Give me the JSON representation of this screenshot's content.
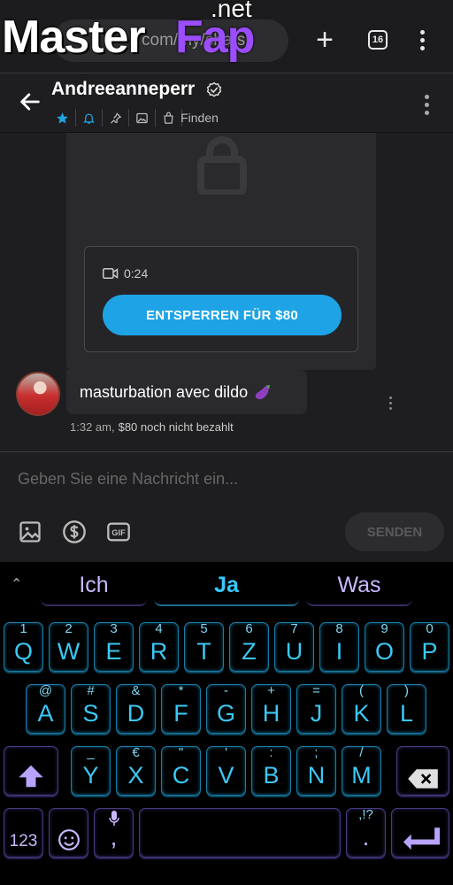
{
  "browser": {
    "url_text": "com/my/chats",
    "tab_count": "16",
    "watermark": {
      "part1": "Master",
      "part2": "Fap",
      "part3": ".net"
    }
  },
  "header": {
    "name": "Andreeanneperr",
    "find_label": "Finden"
  },
  "message_locked": {
    "duration": "0:24",
    "unlock_label": "ENTSPERREN FÜR $80"
  },
  "message": {
    "text": "masturbation avec dildo",
    "time": "1:32 am,",
    "status": "$80 noch nicht bezahlt"
  },
  "composer": {
    "placeholder": "Geben Sie eine Nachricht ein...",
    "send_label": "SENDEN"
  },
  "keyboard": {
    "suggestions": [
      "Ich",
      "Ja",
      "Was"
    ],
    "row1": [
      [
        "Q",
        "1"
      ],
      [
        "W",
        "2"
      ],
      [
        "E",
        "3"
      ],
      [
        "R",
        "4"
      ],
      [
        "T",
        "5"
      ],
      [
        "Z",
        "6"
      ],
      [
        "U",
        "7"
      ],
      [
        "I",
        "8"
      ],
      [
        "O",
        "9"
      ],
      [
        "P",
        "0"
      ]
    ],
    "row2": [
      [
        "A",
        "@"
      ],
      [
        "S",
        "#"
      ],
      [
        "D",
        "&"
      ],
      [
        "F",
        "*"
      ],
      [
        "G",
        "-"
      ],
      [
        "H",
        "+"
      ],
      [
        "J",
        "="
      ],
      [
        "K",
        "("
      ],
      [
        "L",
        ")"
      ]
    ],
    "row3": [
      [
        "Y",
        "_"
      ],
      [
        "X",
        "€"
      ],
      [
        "C",
        "\""
      ],
      [
        "V",
        "'"
      ],
      [
        "B",
        ":"
      ],
      [
        "N",
        ";"
      ],
      [
        "M",
        "/"
      ]
    ],
    "numbers_label": "123",
    "comma_label": ",",
    "period_label": ".",
    "period_sub": ",!?"
  },
  "colors": {
    "accent": "#1ea4e6",
    "key_glow": "#3cc8f5",
    "key_special": "#c9b8ff"
  }
}
